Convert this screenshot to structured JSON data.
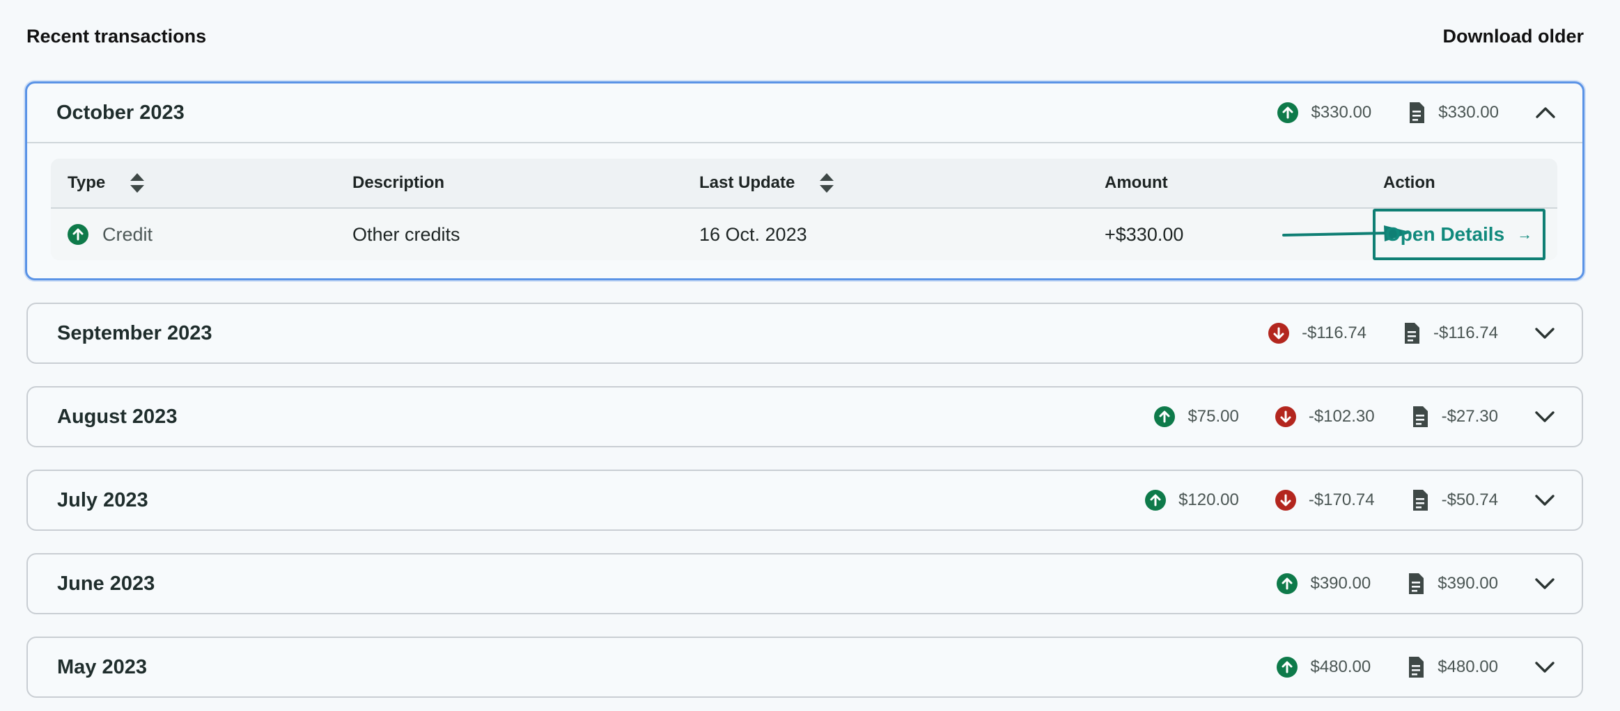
{
  "header": {
    "title": "Recent transactions",
    "download_label": "Download older"
  },
  "colors": {
    "accent": "#10897c",
    "credit": "#0e7a4a",
    "debit": "#b3261e",
    "focus": "#5a93e6"
  },
  "open_month": {
    "label": "October 2023",
    "credit_total": "$330.00",
    "net_total": "$330.00",
    "table": {
      "headers": {
        "type": "Type",
        "description": "Description",
        "last_update": "Last Update",
        "amount": "Amount",
        "action": "Action"
      },
      "rows": [
        {
          "type": "Credit",
          "description": "Other credits",
          "last_update": "16 Oct. 2023",
          "amount": "+$330.00",
          "action": "Open Details",
          "action_icon": "arrow-right-icon"
        }
      ]
    }
  },
  "months": [
    {
      "label": "September 2023",
      "credit_total": "",
      "debit_total": "-$116.74",
      "net_total": "-$116.74"
    },
    {
      "label": "August 2023",
      "credit_total": "$75.00",
      "debit_total": "-$102.30",
      "net_total": "-$27.30"
    },
    {
      "label": "July 2023",
      "credit_total": "$120.00",
      "debit_total": "-$170.74",
      "net_total": "-$50.74"
    },
    {
      "label": "June 2023",
      "credit_total": "$390.00",
      "debit_total": "",
      "net_total": "$390.00"
    },
    {
      "label": "May 2023",
      "credit_total": "$480.00",
      "debit_total": "",
      "net_total": "$480.00"
    }
  ]
}
